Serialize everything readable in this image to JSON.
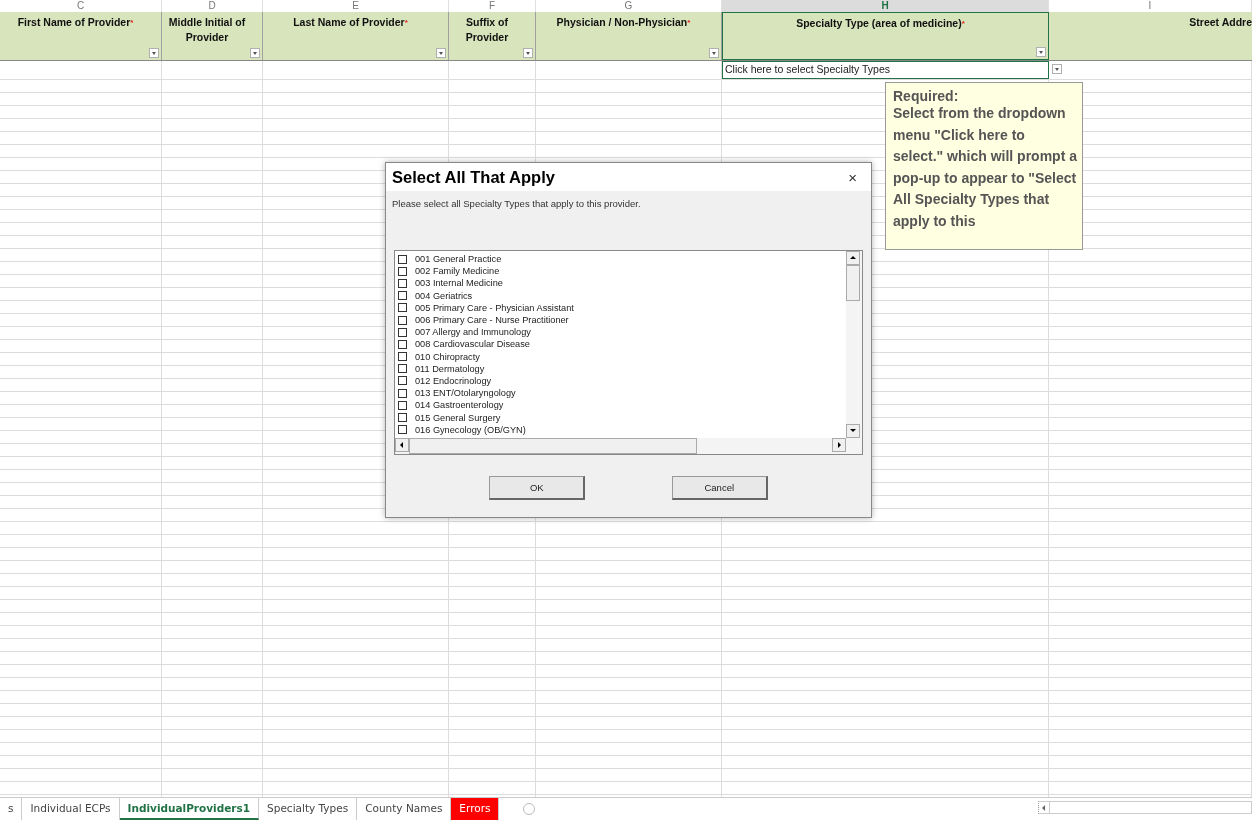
{
  "columns": [
    {
      "letter": "C",
      "selected": false,
      "header": "First Name of Provider",
      "required_mark": "*",
      "filter": true
    },
    {
      "letter": "D",
      "selected": false,
      "header": "Middle Initial of Provider",
      "filter": true
    },
    {
      "letter": "E",
      "selected": false,
      "header": "Last Name of Provider",
      "required_mark": "*",
      "filter": true
    },
    {
      "letter": "F",
      "selected": false,
      "header": "Suffix of Provider",
      "filter": true
    },
    {
      "letter": "G",
      "selected": false,
      "header": "Physician / Non-Physician",
      "required_mark": "*",
      "filter": true
    },
    {
      "letter": "H",
      "selected": true,
      "header": "Specialty Type  (area of medicine)",
      "required_mark": "*",
      "filter": true,
      "cell_value": "Click here to select Specialty Types",
      "cell_dropdown": true
    },
    {
      "letter": "I",
      "selected": false,
      "header": "Street Addre",
      "filter": false
    }
  ],
  "comment": {
    "title": "Required:",
    "body": "Select from the dropdown menu \"Click here to select.\" which will prompt a pop-up to appear to \"Select All Specialty Types that apply to this"
  },
  "dialog": {
    "title": "Select All That Apply",
    "close": "×",
    "message": "Please select all Specialty Types that apply to this provider.",
    "options": [
      {
        "label": "001 General Practice",
        "checked": false
      },
      {
        "label": "002 Family Medicine",
        "checked": false
      },
      {
        "label": "003 Internal Medicine",
        "checked": false
      },
      {
        "label": "004 Geriatrics",
        "checked": false
      },
      {
        "label": "005 Primary Care - Physician Assistant",
        "checked": false
      },
      {
        "label": "006 Primary Care - Nurse Practitioner",
        "checked": false
      },
      {
        "label": "007 Allergy and Immunology",
        "checked": false
      },
      {
        "label": "008 Cardiovascular Disease",
        "checked": false
      },
      {
        "label": "010 Chiropracty",
        "checked": false
      },
      {
        "label": "011 Dermatology",
        "checked": false
      },
      {
        "label": "012 Endocrinology",
        "checked": false
      },
      {
        "label": "013 ENT/Otolaryngology",
        "checked": false
      },
      {
        "label": "014 Gastroenterology",
        "checked": false
      },
      {
        "label": "015 General Surgery",
        "checked": false
      },
      {
        "label": "016 Gynecology (OB/GYN)",
        "checked": false
      }
    ],
    "buttons": [
      "OK",
      "Cancel"
    ]
  },
  "sheet_tabs": [
    {
      "label": "s",
      "selected": false
    },
    {
      "label": "Individual ECPs",
      "selected": false
    },
    {
      "label": "IndividualProviders1",
      "selected": true
    },
    {
      "label": "Specialty Types",
      "selected": false
    },
    {
      "label": "County Names",
      "selected": false
    },
    {
      "label": "Errors",
      "selected": false,
      "color": "#ff0000"
    }
  ]
}
